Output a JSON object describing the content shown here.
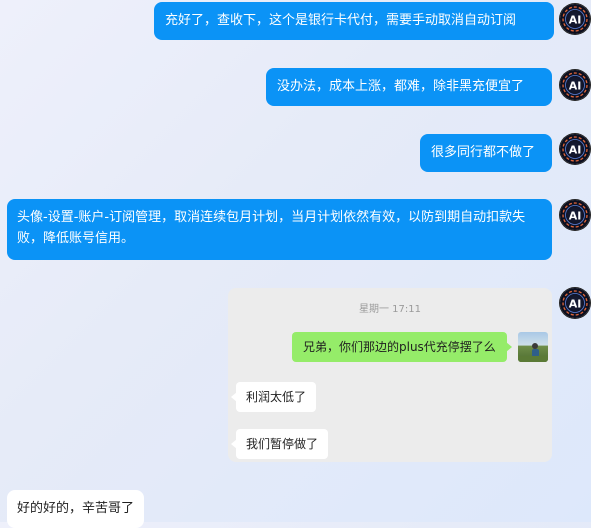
{
  "messages": {
    "m1": "充好了，查收下，这个是银行卡代付，需要手动取消自动订阅",
    "m2": "没办法，成本上涨，都难，除非黑充便宜了",
    "m3": "很多同行都不做了",
    "m4": "头像-设置-账户-订阅管理，取消连续包月计划，当月计划依然有效，以防到期自动扣款失败，降低账号信用。"
  },
  "quoted_chat": {
    "time": "星期一 17:11",
    "outgoing": "兄弟，你们那边的plus代充停摆了么",
    "replies": [
      "利润太低了",
      "我们暂停做了"
    ]
  },
  "reply": "好的好的，辛苦哥了",
  "avatar_text": "AI",
  "colors": {
    "blue_bubble": "#0b93f6",
    "green_bubble": "#95ec69",
    "card_bg": "#ececec"
  }
}
